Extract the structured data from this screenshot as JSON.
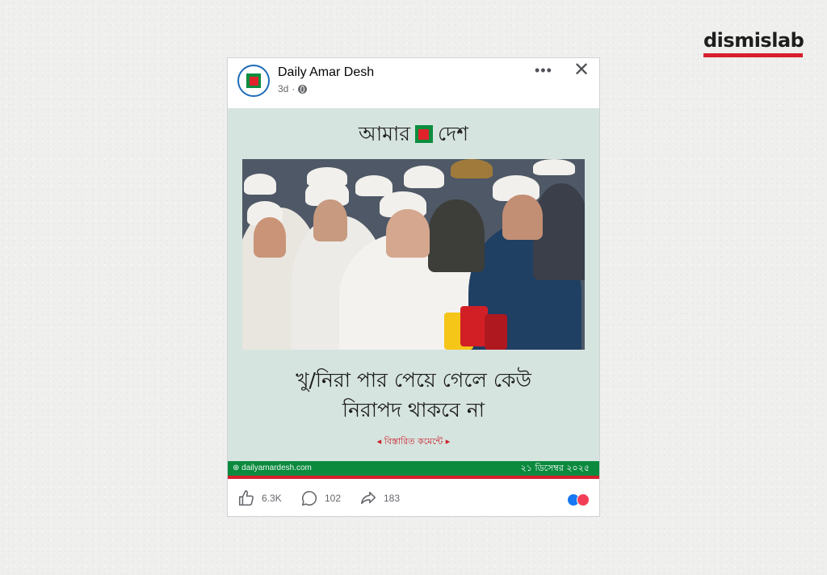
{
  "brand": {
    "name": "dismislab",
    "accent": "#d71f2e"
  },
  "post": {
    "page_name": "Daily Amar Desh",
    "time": "3d",
    "dot": "·",
    "privacy_icon": "globe-icon",
    "more_icon": "•••",
    "close_icon": "✕"
  },
  "card": {
    "logo_word_1": "আমার",
    "logo_word_2": "দেশ",
    "headline_line_1": "খু/নিরা পার পেয়ে গেলে কেউ",
    "headline_line_2": "নিরাপদ থাকবে না",
    "cta": "বিস্তারিত কমেন্টে",
    "website": "dailyamardesh.com",
    "date": "২১ ডিসেম্বর ২০২৫",
    "colors": {
      "background": "#d6e4df",
      "green": "#0b8a3e",
      "red": "#d71f2e"
    }
  },
  "engagement": {
    "likes": "6.3K",
    "comments": "102",
    "shares": "183",
    "reactions": [
      "like-icon",
      "love-icon"
    ]
  }
}
